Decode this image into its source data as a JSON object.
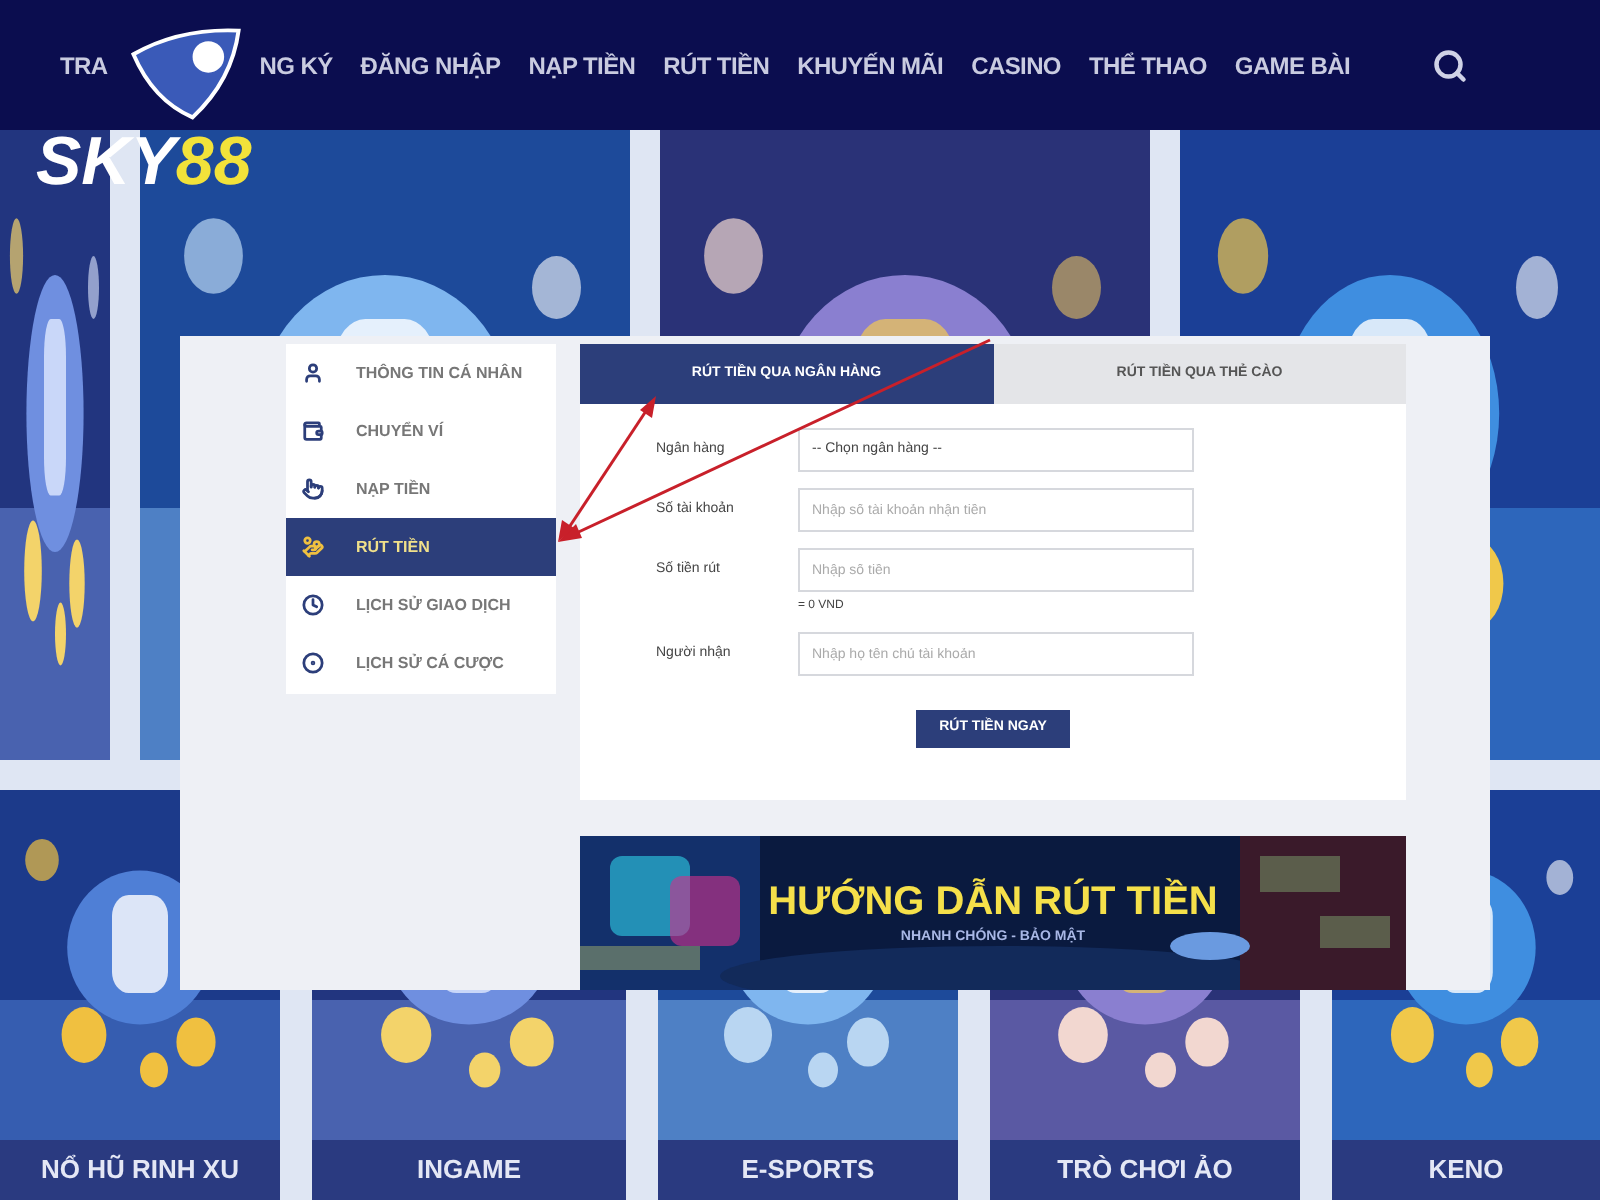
{
  "header": {
    "logo_text": "SKY",
    "logo_number": "88",
    "nav": [
      {
        "label": "TRA"
      },
      {
        "label": "NG KÝ"
      },
      {
        "label": "ĐĂNG NHẬP"
      },
      {
        "label": "NẠP TIỀN"
      },
      {
        "label": "RÚT TIỀN"
      },
      {
        "label": "KHUYẾN MÃI"
      },
      {
        "label": "CASINO"
      },
      {
        "label": "THỂ THAO"
      },
      {
        "label": "GAME BÀI"
      }
    ]
  },
  "sidebar": {
    "items": [
      {
        "label": "THÔNG TIN CÁ NHÂN",
        "selected": false
      },
      {
        "label": "CHUYỂN VÍ",
        "selected": false
      },
      {
        "label": "NẠP TIỀN",
        "selected": false
      },
      {
        "label": "RÚT TIỀN",
        "selected": true
      },
      {
        "label": "LỊCH SỬ GIAO DỊCH",
        "selected": false
      },
      {
        "label": "LỊCH SỬ CÁ CƯỢC",
        "selected": false
      }
    ]
  },
  "withdraw": {
    "tabs": [
      {
        "label": "RÚT TIỀN QUA NGÂN HÀNG",
        "selected": true
      },
      {
        "label": "RÚT TIỀN QUA THẺ CÀO",
        "selected": false
      }
    ],
    "fields": [
      {
        "label": "Ngân hàng",
        "kind": "select",
        "value": "-- Chọn ngân hàng --"
      },
      {
        "label": "Số tài khoản",
        "kind": "text",
        "placeholder": "Nhập số tài khoản nhận tiền"
      },
      {
        "label": "Số tiền rút",
        "kind": "text",
        "placeholder": "Nhập số tiền",
        "note": "= 0 VND"
      },
      {
        "label": "Người nhận",
        "kind": "text",
        "placeholder": "Nhập họ tên chủ tài khoản"
      }
    ],
    "submit": "RÚT TIỀN NGAY"
  },
  "banner": {
    "title": "HƯỚNG DẪN RÚT TIỀN",
    "subtitle": "NHANH CHÓNG - BẢO MẬT"
  },
  "games": [
    {
      "label": "NỔ HŨ RINH XU"
    },
    {
      "label": "INGAME"
    },
    {
      "label": "E-SPORTS"
    },
    {
      "label": "TRÒ CHƠI ẢO"
    },
    {
      "label": "KENO"
    }
  ]
}
